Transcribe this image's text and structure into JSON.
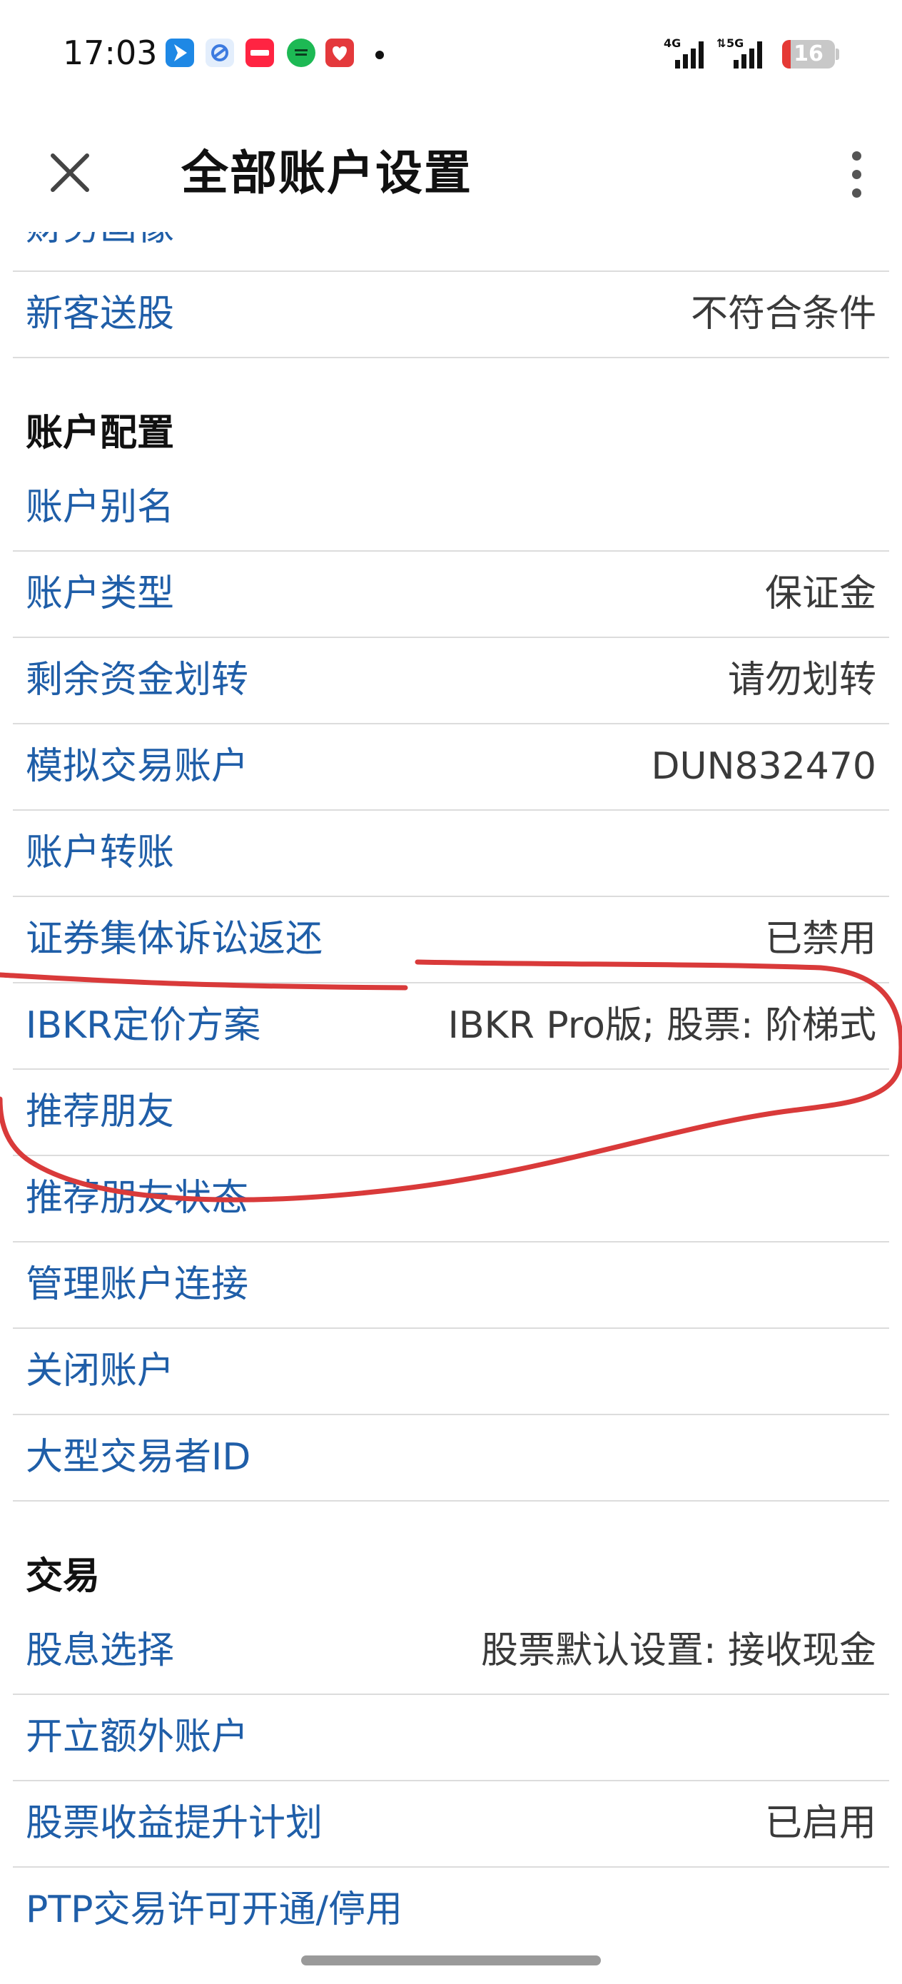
{
  "status_bar": {
    "time": "17:03",
    "network_1": "4G",
    "network_2": "5G",
    "battery_level": "16"
  },
  "header": {
    "title": "全部账户设置"
  },
  "rows_top": [
    {
      "label": "财务画像",
      "value": ""
    },
    {
      "label": "新客送股",
      "value": "不符合条件"
    }
  ],
  "section_account": {
    "title": "账户配置",
    "rows": [
      {
        "label": "账户别名",
        "value": ""
      },
      {
        "label": "账户类型",
        "value": "保证金"
      },
      {
        "label": "剩余资金划转",
        "value": "请勿划转"
      },
      {
        "label": "模拟交易账户",
        "value": "DUN832470"
      },
      {
        "label": "账户转账",
        "value": ""
      },
      {
        "label": "证券集体诉讼返还",
        "value": "已禁用"
      },
      {
        "label": "IBKR定价方案",
        "value": "IBKR Pro版; 股票: 阶梯式"
      },
      {
        "label": "推荐朋友",
        "value": ""
      },
      {
        "label": "推荐朋友状态",
        "value": ""
      },
      {
        "label": "管理账户连接",
        "value": ""
      },
      {
        "label": "关闭账户",
        "value": ""
      },
      {
        "label": "大型交易者ID",
        "value": ""
      }
    ]
  },
  "section_trading": {
    "title": "交易",
    "rows": [
      {
        "label": "股息选择",
        "value": "股票默认设置: 接收现金"
      },
      {
        "label": "开立额外账户",
        "value": ""
      },
      {
        "label": "股票收益提升计划",
        "value": "已启用"
      },
      {
        "label": "PTP交易许可开通/停用",
        "value": ""
      }
    ]
  },
  "colors": {
    "link": "#1f5ea8",
    "annotation": "#d93a3a"
  }
}
